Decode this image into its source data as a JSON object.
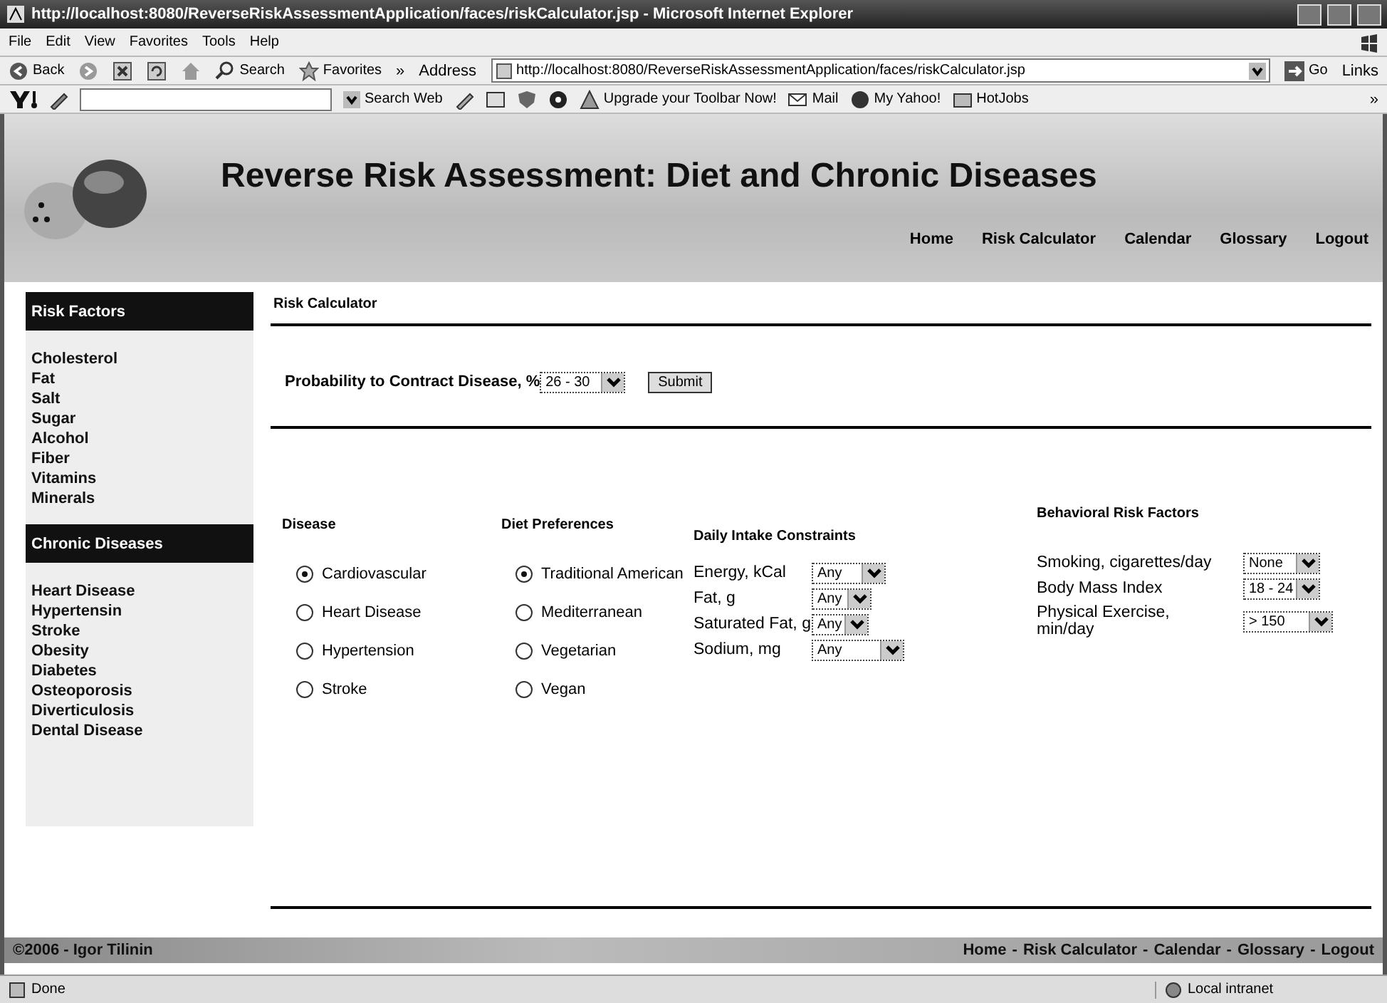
{
  "window": {
    "title": "http://localhost:8080/ReverseRiskAssessmentApplication/faces/riskCalculator.jsp - Microsoft Internet Explorer"
  },
  "menu_bar": [
    "File",
    "Edit",
    "View",
    "Favorites",
    "Tools",
    "Help"
  ],
  "toolbar": {
    "back": "Back",
    "search": "Search",
    "favorites": "Favorites",
    "overflow": "»",
    "address_label": "Address",
    "address": "http://localhost:8080/ReverseRiskAssessmentApplication/faces/riskCalculator.jsp",
    "go": "Go",
    "links": "Links"
  },
  "yahoo_toolbar": {
    "search_web": "Search Web",
    "upgrade": "Upgrade your Toolbar Now!",
    "mail": "Mail",
    "my_yahoo": "My Yahoo!",
    "hotjobs": "HotJobs",
    "overflow": "»"
  },
  "header": {
    "title": "Reverse Risk Assessment: Diet and Chronic Diseases",
    "nav": [
      "Home",
      "Risk Calculator",
      "Calendar",
      "Glossary",
      "Logout"
    ]
  },
  "sidebar": [
    {
      "heading": "Risk Factors",
      "items": [
        "Cholesterol",
        "Fat",
        "Salt",
        "Sugar",
        "Alcohol",
        "Fiber",
        "Vitamins",
        "Minerals"
      ]
    },
    {
      "heading": "Chronic Diseases",
      "items": [
        "Heart Disease",
        "Hypertensin",
        "Stroke",
        "Obesity",
        "Diabetes",
        "Osteoporosis",
        "Diverticulosis",
        "Dental Disease"
      ]
    }
  ],
  "content": {
    "heading": "Risk Calculator",
    "probability": {
      "label": "Probability to Contract Disease, %",
      "value": "26 - 30"
    },
    "submit": "Submit",
    "disease": {
      "heading": "Disease",
      "options": [
        {
          "label": "Cardiovascular",
          "selected": true
        },
        {
          "label": "Heart Disease",
          "selected": false
        },
        {
          "label": "Hypertension",
          "selected": false
        },
        {
          "label": "Stroke",
          "selected": false
        }
      ]
    },
    "diet": {
      "heading": "Diet Preferences",
      "options": [
        {
          "label": "Traditional American",
          "selected": true
        },
        {
          "label": "Mediterranean",
          "selected": false
        },
        {
          "label": "Vegetarian",
          "selected": false
        },
        {
          "label": "Vegan",
          "selected": false
        }
      ]
    },
    "intake": {
      "heading": "Daily Intake Constraints",
      "fields": [
        {
          "label": "Energy, kCal",
          "value": "Any"
        },
        {
          "label": "Fat, g",
          "value": "Any"
        },
        {
          "label": "Saturated Fat, g",
          "value": "Any"
        },
        {
          "label": "Sodium, mg",
          "value": "Any"
        }
      ]
    },
    "behavioral": {
      "heading": "Behavioral Risk Factors",
      "fields": [
        {
          "label": "Smoking, cigarettes/day",
          "value": "None"
        },
        {
          "label": "Body Mass Index",
          "value": "18 - 24"
        },
        {
          "label": "Physical Exercise, min/day",
          "value": "> 150"
        }
      ]
    }
  },
  "footer": {
    "copyright": "©2006 - Igor Tilinin",
    "separator": "-",
    "links": [
      "Home",
      "Risk Calculator",
      "Calendar",
      "Glossary",
      "Logout"
    ]
  },
  "status_bar": {
    "text": "Done",
    "zone": "Local intranet"
  }
}
